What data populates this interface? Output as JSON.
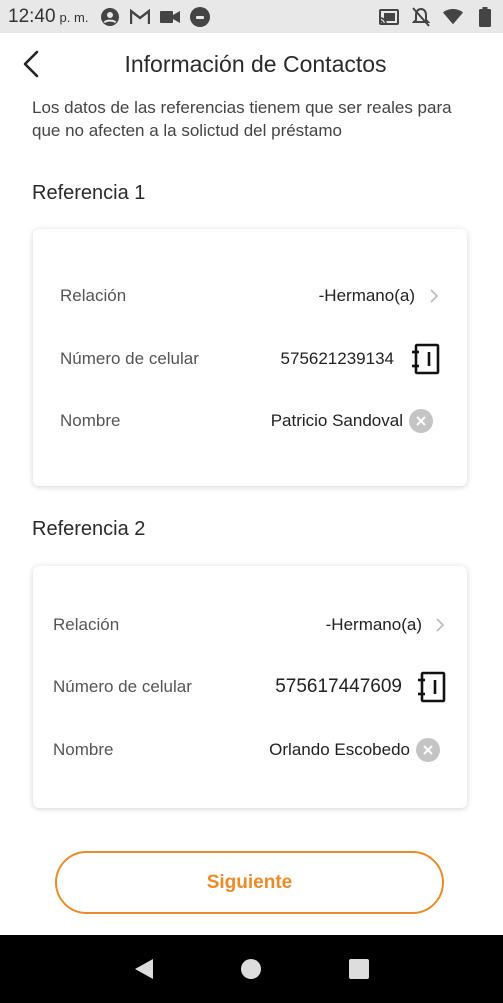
{
  "status_bar": {
    "time": "12:40",
    "ampm": "p. m."
  },
  "header": {
    "title": "Información de Contactos"
  },
  "notice": "Los datos de las referencias tienem que ser reales para que no afecten a la solictud del préstamo",
  "references": [
    {
      "heading": "Referencia 1",
      "relation_label": "Relación",
      "relation_value": "-Hermano(a)",
      "phone_label": "Número de celular",
      "phone_value": "575621239134",
      "name_label": "Nombre",
      "name_value": "Patricio Sandoval"
    },
    {
      "heading": "Referencia 2",
      "relation_label": "Relación",
      "relation_value": "-Hermano(a)",
      "phone_label": "Número de celular",
      "phone_value": "575617447609",
      "name_label": "Nombre",
      "name_value": "Orlando Escobedo"
    }
  ],
  "next_button": "Siguiente",
  "colors": {
    "accent": "#f08a24",
    "clear_icon": "#c4c4c4"
  }
}
